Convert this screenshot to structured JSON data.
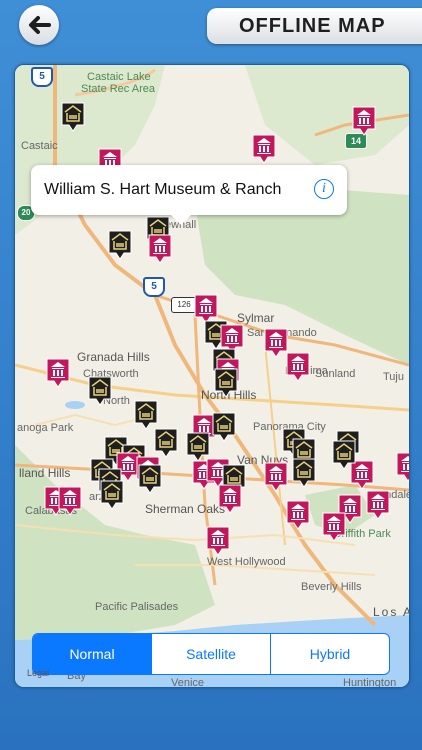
{
  "header": {
    "title": "OFFLINE MAP",
    "back_icon": "back-arrow-icon"
  },
  "callout": {
    "name": "William S. Hart Museum & Ranch",
    "info_glyph": "i"
  },
  "map_labels": {
    "castaic_lake": "Castaic Lake",
    "state_rec_area": "State Rec Area",
    "castaic": "Castaic",
    "newhall": "ewhall",
    "sylmar": "Sylmar",
    "san_fernando": "San Fernando",
    "granada_hills": "Granada Hills",
    "chatsworth": "Chatsworth",
    "pacoima": "Pacoima",
    "sunland": "Sunland",
    "tujunga": "Tuju",
    "northridge": "North",
    "north_hills": "North Hills",
    "panorama_city": "Panorama City",
    "canoga_park": "anoga Park",
    "van_nuys": "Van Nuys",
    "glendale": "endale",
    "woodland_hills": "lland Hills",
    "tarzana": "arzana",
    "calabasas": "Calabasas",
    "sherman_oaks": "Sherman Oaks",
    "griffith_park": "Griffith Park",
    "west_hollywood": "West Hollywood",
    "beverly_hills": "Beverly Hills",
    "pacific_palisades": "Pacific Palisades",
    "los_angeles": "Los A",
    "bay": "Bay",
    "venice": "Venice",
    "huntington": "Huntington",
    "hwy_5_top": "5",
    "hwy_5_mid": "5",
    "hwy_14": "14",
    "hwy_126": "126",
    "hwy_20": "20"
  },
  "map_type": {
    "options": [
      "Normal",
      "Satellite",
      "Hybrid"
    ],
    "selected": "Normal"
  },
  "legal": "Legal",
  "colors": {
    "museum_pin": "#c2185b",
    "hotel_pin": "#1f1f1f",
    "accent": "#0a78ff"
  }
}
